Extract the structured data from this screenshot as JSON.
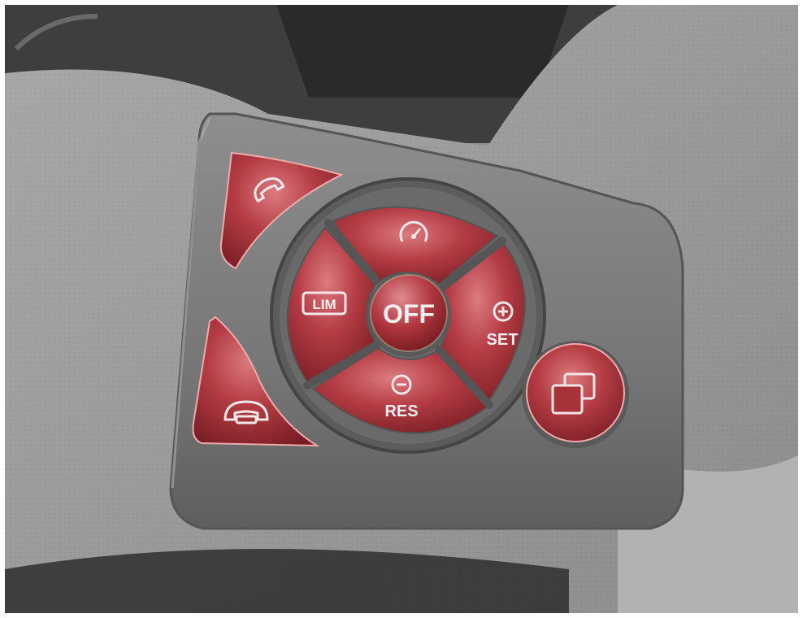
{
  "controls": {
    "off_label": "OFF",
    "set_label": "SET",
    "res_label": "RES",
    "lim_label": "LIM"
  },
  "icons": {
    "accept_call": "phone-accept-icon",
    "end_call": "phone-hangup-icon",
    "speedometer": "speedometer-icon",
    "plus": "plus-icon",
    "minus": "minus-icon",
    "windows": "overlapping-windows-icon"
  },
  "colors": {
    "button_red": "#a8323a",
    "button_red_light": "#d8767c",
    "button_red_dark": "#6e1a20",
    "panel_gray": "#7a7a7a",
    "background_gray": "#9a9a9a"
  }
}
